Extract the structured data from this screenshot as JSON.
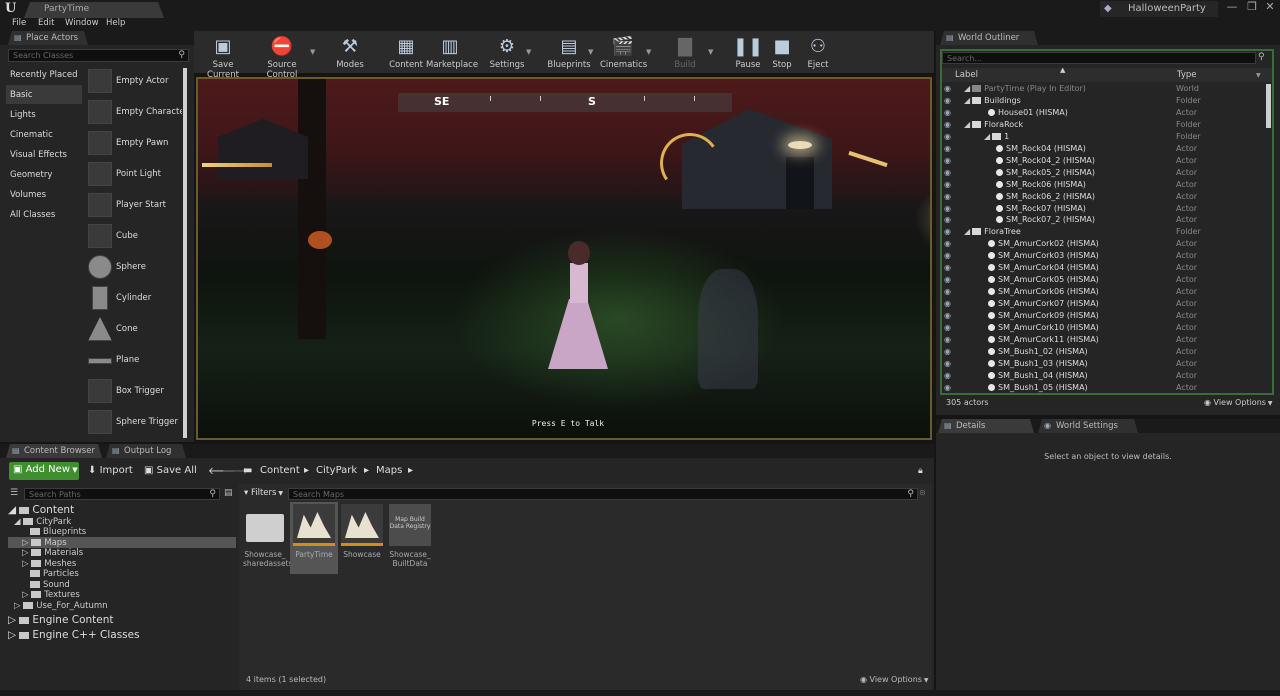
{
  "titlebar": {
    "tab_title": "PartyTime",
    "project": "HalloweenParty",
    "minimize": "—",
    "maximize": "❐",
    "close": "✕"
  },
  "menu": [
    "File",
    "Edit",
    "Window",
    "Help"
  ],
  "place_actors": {
    "tab": "Place Actors",
    "search_placeholder": "Search Classes",
    "categories": [
      "Recently Placed",
      "Basic",
      "Lights",
      "Cinematic",
      "Visual Effects",
      "Geometry",
      "Volumes",
      "All Classes"
    ],
    "selected_category": "Basic",
    "actors": [
      "Empty Actor",
      "Empty Characte",
      "Empty Pawn",
      "Point Light",
      "Player Start",
      "Cube",
      "Sphere",
      "Cylinder",
      "Cone",
      "Plane",
      "Box Trigger",
      "Sphere Trigger"
    ]
  },
  "toolbar": {
    "buttons": [
      "Save Current",
      "Source Control",
      "Modes",
      "Content",
      "Marketplace",
      "Settings",
      "Blueprints",
      "Cinematics",
      "Build",
      "Pause",
      "Stop",
      "Eject"
    ]
  },
  "viewport": {
    "compass": [
      "SE",
      "S"
    ],
    "prompt": "Press E to Talk"
  },
  "content_browser": {
    "tabs": [
      "Content Browser",
      "Output Log"
    ],
    "add_new": "Add New",
    "import": "Import",
    "save_all": "Save All",
    "breadcrumb": [
      "Content",
      "CityPark",
      "Maps"
    ],
    "search_paths_placeholder": "Search Paths",
    "filters": "Filters",
    "search_maps_placeholder": "Search Maps",
    "tree": {
      "content": "Content",
      "citypark": "CityPark",
      "children": [
        "Blueprints",
        "Maps",
        "Materials",
        "Meshes",
        "Particles",
        "Sound",
        "Textures"
      ],
      "use_for_autumn": "Use_For_Autumn",
      "engine_content": "Engine Content",
      "engine_cpp": "Engine C++ Classes"
    },
    "assets": [
      {
        "name": "Showcase_ sharedassets",
        "kind": "folder"
      },
      {
        "name": "PartyTime",
        "kind": "map",
        "selected": true
      },
      {
        "name": "Showcase",
        "kind": "map"
      },
      {
        "name": "Showcase_ BuiltData",
        "kind": "registry",
        "thumb_text": "Map Build Data Registry"
      }
    ],
    "status": "4 items (1 selected)",
    "view_options": "View Options"
  },
  "world_outliner": {
    "tab": "World Outliner",
    "search_placeholder": "Search...",
    "col_label": "Label",
    "col_type": "Type",
    "rows": [
      {
        "label": "PartyTime (Play In Editor)",
        "type": "World",
        "indent": 0,
        "kind": "world"
      },
      {
        "label": "Buildings",
        "type": "Folder",
        "indent": 1,
        "kind": "folder"
      },
      {
        "label": "House01 (HISMA)",
        "type": "Actor",
        "indent": 2,
        "kind": "actor"
      },
      {
        "label": "FloraRock",
        "type": "Folder",
        "indent": 1,
        "kind": "folder"
      },
      {
        "label": "1",
        "type": "Folder",
        "indent": 2,
        "kind": "folder"
      },
      {
        "label": "SM_Rock04 (HISMA)",
        "type": "Actor",
        "indent": 3,
        "kind": "actor"
      },
      {
        "label": "SM_Rock04_2 (HISMA)",
        "type": "Actor",
        "indent": 3,
        "kind": "actor"
      },
      {
        "label": "SM_Rock05_2 (HISMA)",
        "type": "Actor",
        "indent": 3,
        "kind": "actor"
      },
      {
        "label": "SM_Rock06 (HISMA)",
        "type": "Actor",
        "indent": 3,
        "kind": "actor"
      },
      {
        "label": "SM_Rock06_2 (HISMA)",
        "type": "Actor",
        "indent": 3,
        "kind": "actor"
      },
      {
        "label": "SM_Rock07 (HISMA)",
        "type": "Actor",
        "indent": 3,
        "kind": "actor"
      },
      {
        "label": "SM_Rock07_2 (HISMA)",
        "type": "Actor",
        "indent": 3,
        "kind": "actor"
      },
      {
        "label": "FloraTree",
        "type": "Folder",
        "indent": 1,
        "kind": "folder"
      },
      {
        "label": "SM_AmurCork02 (HISMA)",
        "type": "Actor",
        "indent": 2,
        "kind": "actor"
      },
      {
        "label": "SM_AmurCork03 (HISMA)",
        "type": "Actor",
        "indent": 2,
        "kind": "actor"
      },
      {
        "label": "SM_AmurCork04 (HISMA)",
        "type": "Actor",
        "indent": 2,
        "kind": "actor"
      },
      {
        "label": "SM_AmurCork05 (HISMA)",
        "type": "Actor",
        "indent": 2,
        "kind": "actor"
      },
      {
        "label": "SM_AmurCork06 (HISMA)",
        "type": "Actor",
        "indent": 2,
        "kind": "actor"
      },
      {
        "label": "SM_AmurCork07 (HISMA)",
        "type": "Actor",
        "indent": 2,
        "kind": "actor"
      },
      {
        "label": "SM_AmurCork09 (HISMA)",
        "type": "Actor",
        "indent": 2,
        "kind": "actor"
      },
      {
        "label": "SM_AmurCork10 (HISMA)",
        "type": "Actor",
        "indent": 2,
        "kind": "actor"
      },
      {
        "label": "SM_AmurCork11 (HISMA)",
        "type": "Actor",
        "indent": 2,
        "kind": "actor"
      },
      {
        "label": "SM_Bush1_02 (HISMA)",
        "type": "Actor",
        "indent": 2,
        "kind": "actor"
      },
      {
        "label": "SM_Bush1_03 (HISMA)",
        "type": "Actor",
        "indent": 2,
        "kind": "actor"
      },
      {
        "label": "SM_Bush1_04 (HISMA)",
        "type": "Actor",
        "indent": 2,
        "kind": "actor"
      },
      {
        "label": "SM_Bush1_05 (HISMA)",
        "type": "Actor",
        "indent": 2,
        "kind": "actor"
      }
    ],
    "count": "305 actors",
    "view_options": "View Options"
  },
  "details": {
    "tabs": [
      "Details",
      "World Settings"
    ],
    "empty_message": "Select an object to view details."
  },
  "colors": {
    "accent_green": "#3f8f2e",
    "selection_orange": "#d88a1a",
    "viewport_border": "#6b5a2a"
  }
}
